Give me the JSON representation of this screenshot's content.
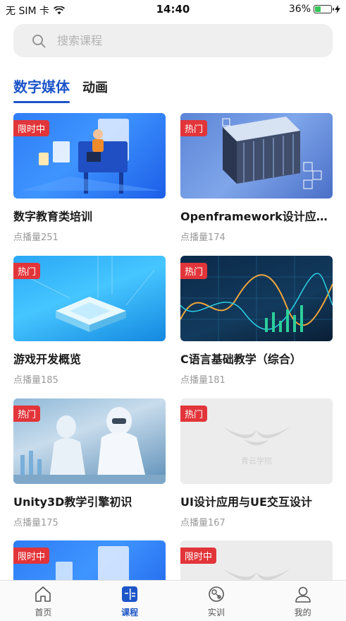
{
  "status_bar": {
    "carrier": "无 SIM 卡",
    "time": "14:40",
    "battery": "36%",
    "battery_level": 0.36
  },
  "search": {
    "placeholder": "搜索课程"
  },
  "tabs": [
    {
      "label": "数字媒体",
      "active": true
    },
    {
      "label": "动画",
      "active": false
    }
  ],
  "courses": [
    {
      "title": "数字教育类培训",
      "views": "点播量251",
      "badge": "限时中"
    },
    {
      "title": "Openframework设计应用...",
      "views": "点播量174",
      "badge": "热门"
    },
    {
      "title": "游戏开发概览",
      "views": "点播量185",
      "badge": "热门"
    },
    {
      "title": "C语言基础教学（综合）",
      "views": "点播量181",
      "badge": "热门"
    },
    {
      "title": "Unity3D教学引擎初识",
      "views": "点播量175",
      "badge": "热门"
    },
    {
      "title": "UI设计应用与UE交互设计",
      "views": "点播量167",
      "badge": "热门",
      "thumb_text": "青云学院"
    },
    {
      "badge": "限时中"
    },
    {
      "badge": "限时中"
    }
  ],
  "bottom_nav": [
    {
      "label": "首页",
      "icon": "home-icon",
      "active": false
    },
    {
      "label": "课程",
      "icon": "course-icon",
      "active": true
    },
    {
      "label": "实训",
      "icon": "training-icon",
      "active": false
    },
    {
      "label": "我的",
      "icon": "profile-icon",
      "active": false
    }
  ],
  "colors": {
    "accent": "#1d55c8",
    "badge": "#e2353a"
  }
}
